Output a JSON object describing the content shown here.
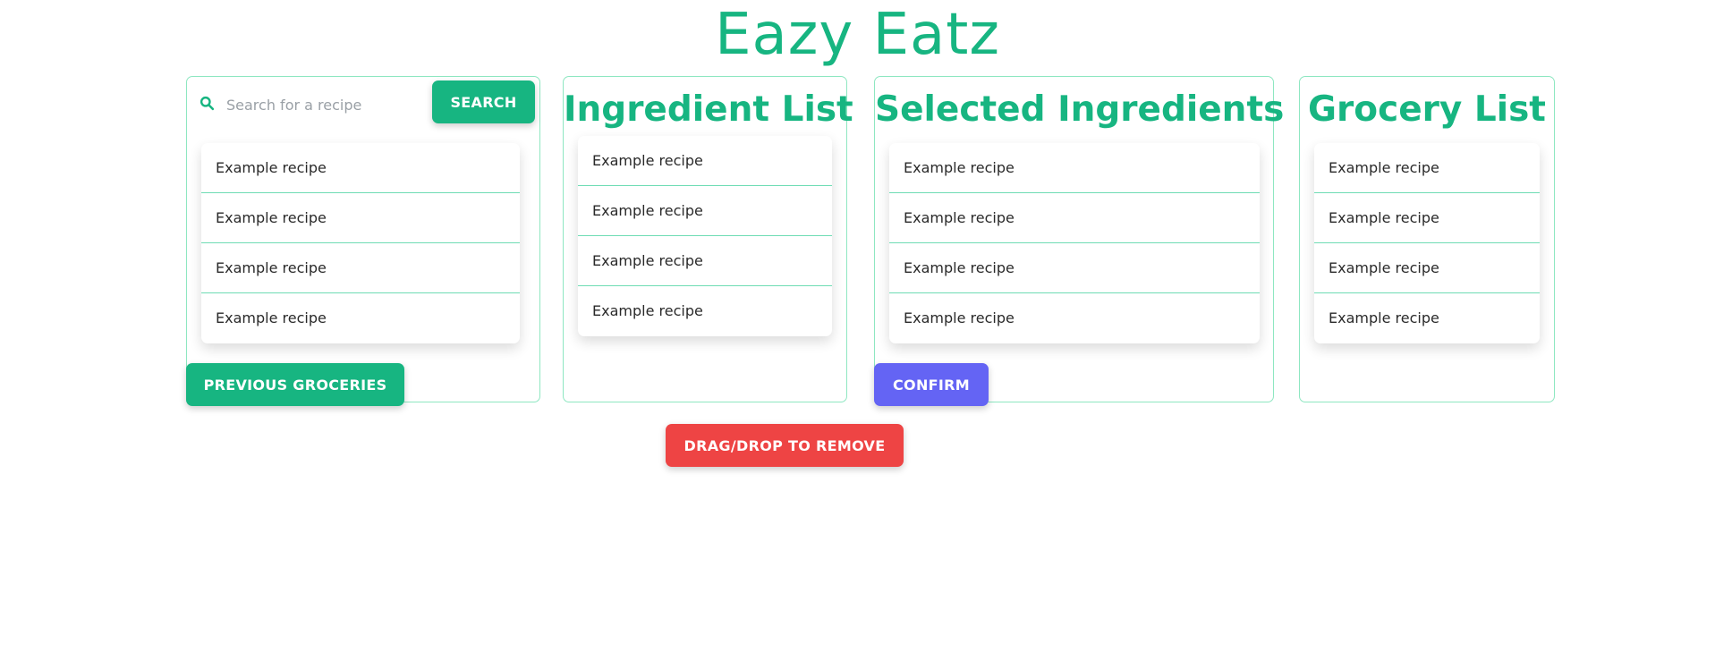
{
  "app": {
    "title": "Eazy Eatz"
  },
  "colors": {
    "brand_green": "#17b581",
    "border_green": "#8ee7c1",
    "confirm_indigo": "#6464f4",
    "remove_red": "#ee4444"
  },
  "search": {
    "placeholder": "Search for a recipe",
    "value": "",
    "button_label": "SEARCH",
    "icon": "search-icon"
  },
  "recipes": {
    "items": [
      "Example recipe",
      "Example recipe",
      "Example recipe",
      "Example recipe"
    ],
    "previous_groceries_label": "PREVIOUS GROCERIES"
  },
  "ingredient_list": {
    "title": "Ingredient List",
    "items": [
      "Example recipe",
      "Example recipe",
      "Example recipe",
      "Example recipe"
    ]
  },
  "selected_ingredients": {
    "title": "Selected Ingredients",
    "items": [
      "Example recipe",
      "Example recipe",
      "Example recipe",
      "Example recipe"
    ],
    "confirm_label": "CONFIRM"
  },
  "grocery_list": {
    "title": "Grocery List",
    "items": [
      "Example recipe",
      "Example recipe",
      "Example recipe",
      "Example recipe"
    ]
  },
  "remove_zone": {
    "label": "DRAG/DROP TO REMOVE"
  }
}
